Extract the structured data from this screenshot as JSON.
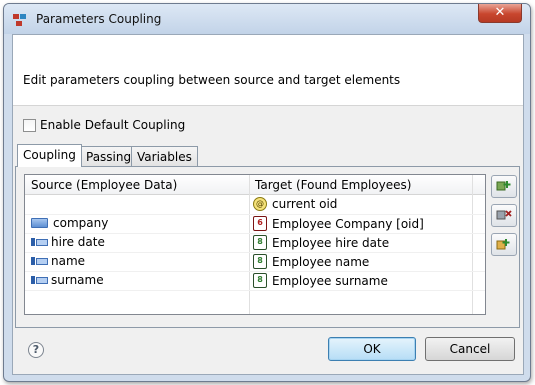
{
  "window": {
    "title": "Parameters Coupling",
    "close_label": "✕"
  },
  "header": {
    "description": "Edit parameters coupling between source and target elements"
  },
  "default_coupling": {
    "label": "Enable Default Coupling",
    "checked": false
  },
  "tabs": [
    {
      "label": "Coupling",
      "active": true
    },
    {
      "label": "Passing",
      "active": false
    },
    {
      "label": "Variables",
      "active": false
    }
  ],
  "table": {
    "columns": [
      "Source (Employee Data)",
      "Target (Found Employees)"
    ],
    "rows": [
      {
        "source": "",
        "source_icon": "",
        "target": "current oid",
        "target_icon": "oid-icon"
      },
      {
        "source": "company",
        "source_icon": "attribute-icon",
        "target": "Employee Company [oid]",
        "target_icon": "reference-red-icon"
      },
      {
        "source": "hire date",
        "source_icon": "key-attribute-icon",
        "target": "Employee hire date",
        "target_icon": "parameter-green-icon"
      },
      {
        "source": "name",
        "source_icon": "key-attribute-icon",
        "target": "Employee name",
        "target_icon": "parameter-green-icon"
      },
      {
        "source": "surname",
        "source_icon": "key-attribute-icon",
        "target": "Employee surname",
        "target_icon": "parameter-green-icon"
      }
    ]
  },
  "side_buttons": [
    "add-coupling-icon",
    "remove-coupling-icon",
    "edit-coupling-icon"
  ],
  "footer": {
    "help": "?",
    "ok_label": "OK",
    "cancel_label": "Cancel"
  }
}
